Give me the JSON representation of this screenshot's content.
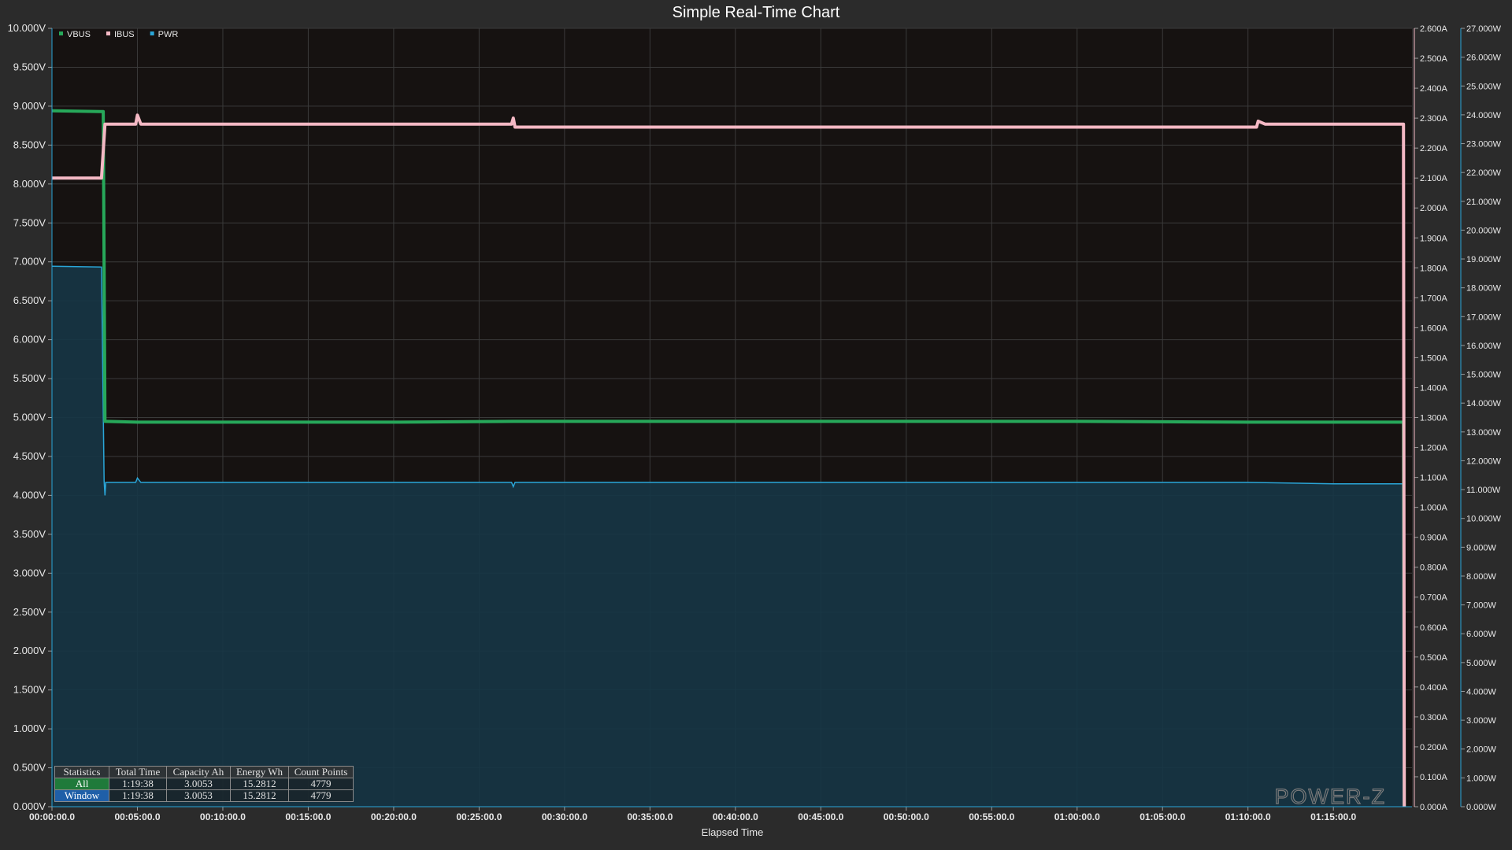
{
  "chart_data": {
    "type": "line",
    "title": "Simple Real-Time Chart",
    "xlabel": "Elapsed Time",
    "x_unit": "minutes",
    "xlim": [
      0,
      79.6
    ],
    "x_ticks": [
      {
        "v": 0,
        "label": "00:00:00.0"
      },
      {
        "v": 5,
        "label": "00:05:00.0"
      },
      {
        "v": 10,
        "label": "00:10:00.0"
      },
      {
        "v": 15,
        "label": "00:15:00.0"
      },
      {
        "v": 20,
        "label": "00:20:00.0"
      },
      {
        "v": 25,
        "label": "00:25:00.0"
      },
      {
        "v": 30,
        "label": "00:30:00.0"
      },
      {
        "v": 35,
        "label": "00:35:00.0"
      },
      {
        "v": 40,
        "label": "00:40:00.0"
      },
      {
        "v": 45,
        "label": "00:45:00.0"
      },
      {
        "v": 50,
        "label": "00:50:00.0"
      },
      {
        "v": 55,
        "label": "00:55:00.0"
      },
      {
        "v": 60,
        "label": "01:00:00.0"
      },
      {
        "v": 65,
        "label": "01:05:00.0"
      },
      {
        "v": 70,
        "label": "01:10:00.0"
      },
      {
        "v": 75,
        "label": "01:15:00.0"
      }
    ],
    "axes": {
      "left": {
        "unit": "V",
        "min": 0,
        "max": 10,
        "step": 0.5,
        "decimals": 3,
        "color": "#e8e8e8"
      },
      "right1": {
        "unit": "A",
        "min": 0,
        "max": 2.6,
        "step": 0.1,
        "decimals": 3,
        "color": "#e8e8e8"
      },
      "right2": {
        "unit": "W",
        "min": 0,
        "max": 27,
        "step": 1,
        "decimals": 3,
        "color": "#e8e8e8"
      }
    },
    "grid": true,
    "legend": {
      "placement": "top-left"
    },
    "series": [
      {
        "name": "VBUS",
        "axis": "left",
        "color": "#27a85a",
        "style": "line",
        "points": [
          [
            0,
            8.94
          ],
          [
            3.0,
            8.93
          ],
          [
            3.1,
            4.95
          ],
          [
            5,
            4.94
          ],
          [
            20,
            4.94
          ],
          [
            27,
            4.95
          ],
          [
            40,
            4.95
          ],
          [
            60,
            4.95
          ],
          [
            70,
            4.94
          ],
          [
            79.1,
            4.94
          ],
          [
            79.15,
            0.0
          ]
        ]
      },
      {
        "name": "IBUS",
        "axis": "right1",
        "color": "#f4b8c4",
        "style": "line",
        "points": [
          [
            0,
            2.1
          ],
          [
            2.9,
            2.1
          ],
          [
            3.1,
            2.28
          ],
          [
            4.9,
            2.28
          ],
          [
            5.0,
            2.31
          ],
          [
            5.2,
            2.28
          ],
          [
            15,
            2.28
          ],
          [
            25,
            2.28
          ],
          [
            26.9,
            2.28
          ],
          [
            27.0,
            2.3
          ],
          [
            27.1,
            2.27
          ],
          [
            35,
            2.27
          ],
          [
            50,
            2.27
          ],
          [
            70.5,
            2.27
          ],
          [
            70.6,
            2.29
          ],
          [
            71,
            2.28
          ],
          [
            79.0,
            2.28
          ],
          [
            79.1,
            2.28
          ],
          [
            79.15,
            0.0
          ]
        ]
      },
      {
        "name": "PWR",
        "axis": "right2",
        "color": "#2aa6d8",
        "style": "area",
        "fill": "#163646",
        "points": [
          [
            0,
            18.75
          ],
          [
            2.9,
            18.72
          ],
          [
            3.05,
            11.3
          ],
          [
            3.1,
            10.8
          ],
          [
            3.15,
            11.25
          ],
          [
            4.9,
            11.25
          ],
          [
            5.0,
            11.4
          ],
          [
            5.2,
            11.25
          ],
          [
            20,
            11.25
          ],
          [
            26.9,
            11.25
          ],
          [
            27.0,
            11.1
          ],
          [
            27.1,
            11.25
          ],
          [
            70,
            11.25
          ],
          [
            75,
            11.2
          ],
          [
            79.1,
            11.2
          ],
          [
            79.15,
            0.0
          ]
        ]
      }
    ]
  },
  "statistics": {
    "headers": [
      "Statistics",
      "Total Time",
      "Capacity Ah",
      "Energy Wh",
      "Count Points"
    ],
    "rows": [
      {
        "label": "All",
        "total_time": "1:19:38",
        "capacity_ah": "3.0053",
        "energy_wh": "15.2812",
        "count_points": "4779"
      },
      {
        "label": "Window",
        "total_time": "1:19:38",
        "capacity_ah": "3.0053",
        "energy_wh": "15.2812",
        "count_points": "4779"
      }
    ]
  },
  "watermark": "POWER-Z"
}
